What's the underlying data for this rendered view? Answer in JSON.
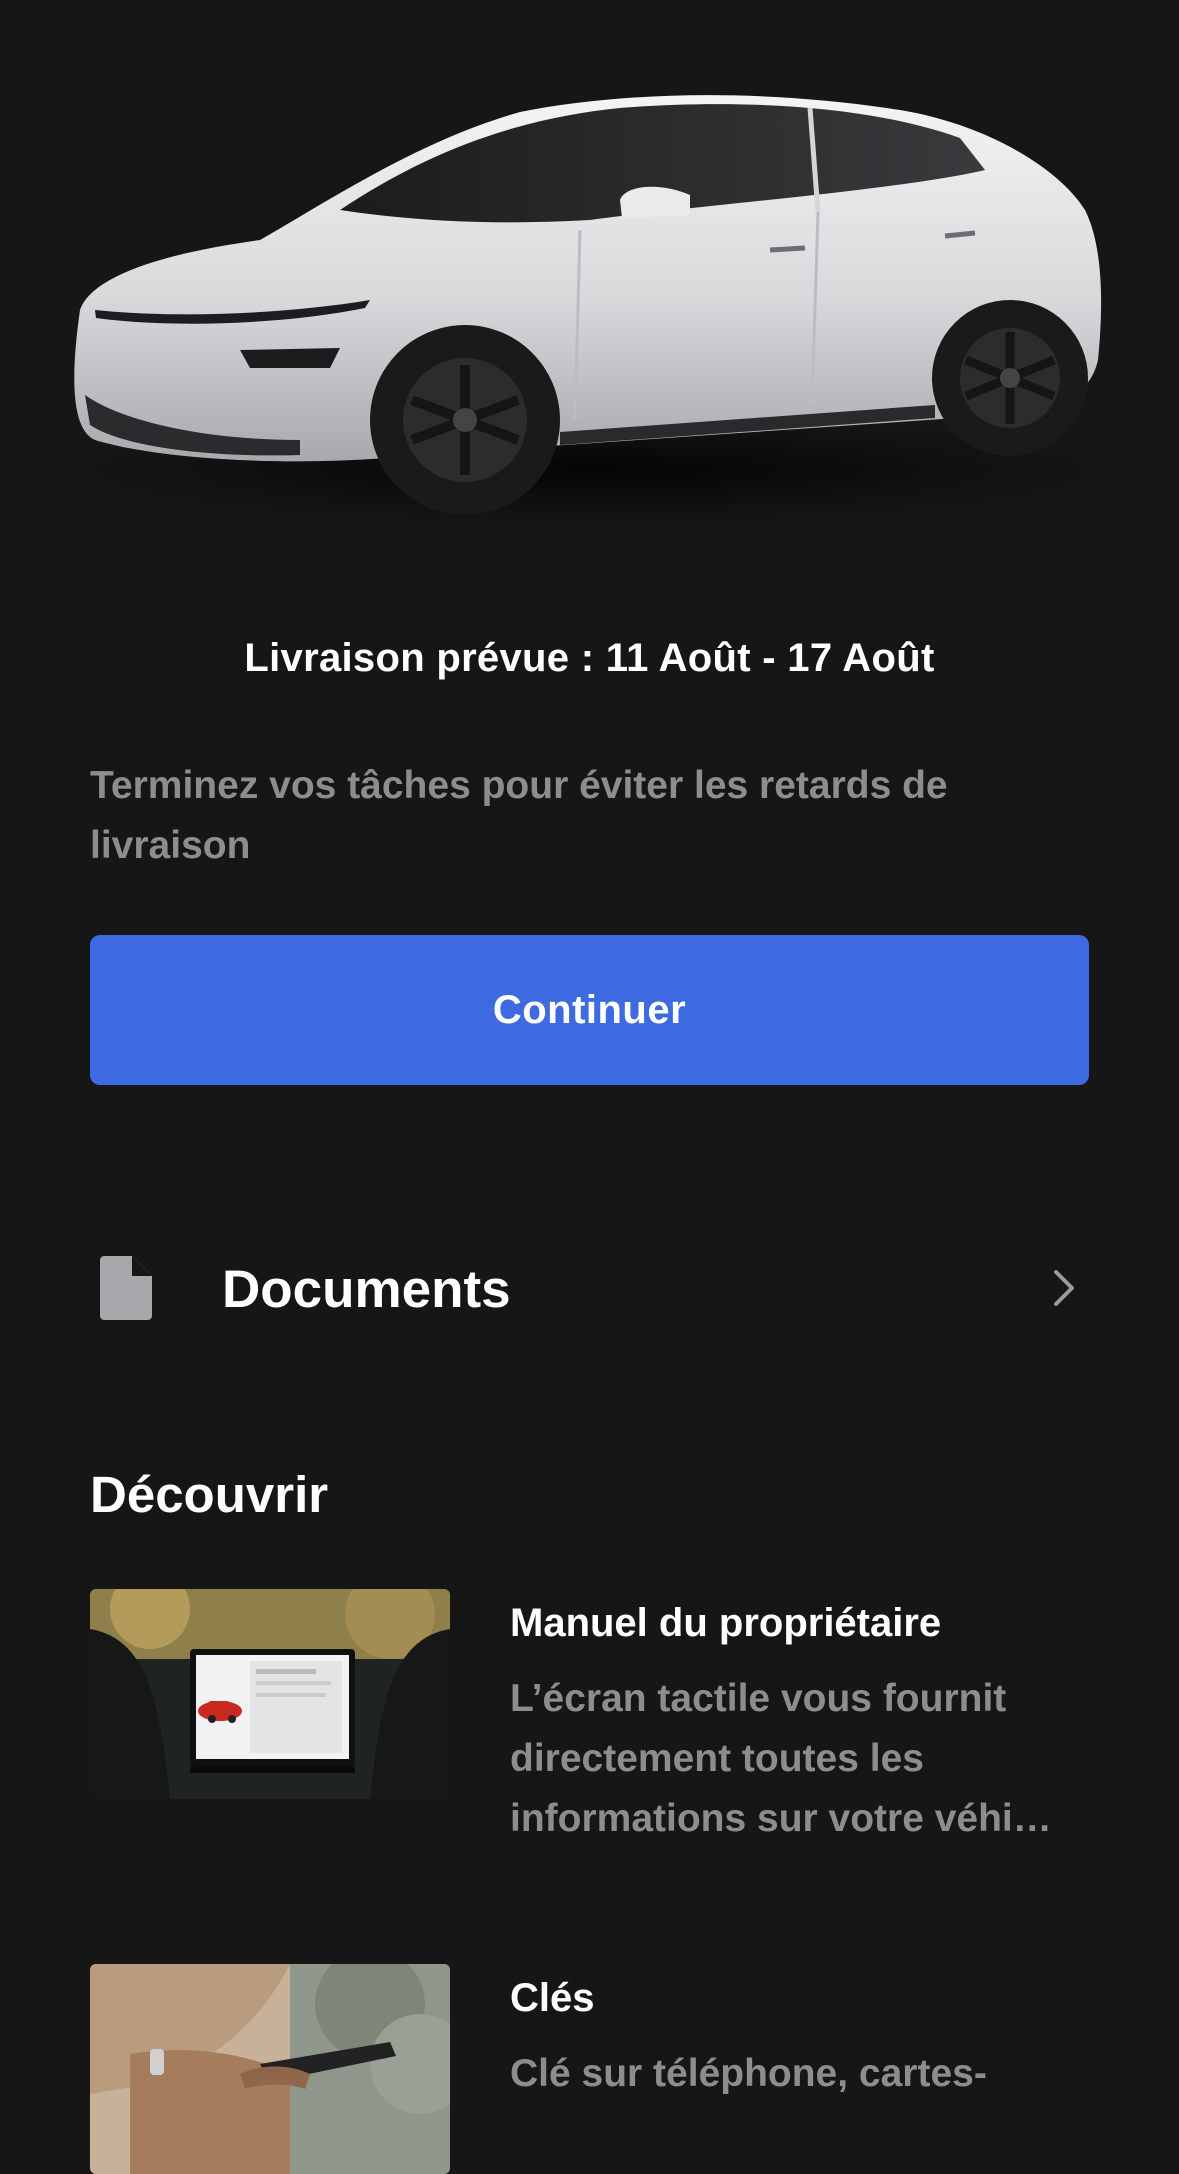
{
  "hero": {
    "image_name": "vehicle-image"
  },
  "delivery": {
    "text": "Livraison prévue : 11 Août - 17 Août"
  },
  "tasks": {
    "message": "Terminez vos tâches pour éviter les retards de livraison",
    "button_label": "Continuer"
  },
  "documents": {
    "label": "Documents",
    "icon": "document-icon",
    "chevron": "chevron-right-icon"
  },
  "discover": {
    "title": "Découvrir",
    "cards": [
      {
        "title": "Manuel du propriétaire",
        "description": "L’écran tactile vous fournit directement toutes les informations sur votre véhi…"
      },
      {
        "title": "Clés",
        "description": "Clé sur téléphone, cartes-"
      }
    ]
  },
  "colors": {
    "background": "#161617",
    "accent": "#3e6ae1",
    "secondary_text": "#8d8d90"
  }
}
